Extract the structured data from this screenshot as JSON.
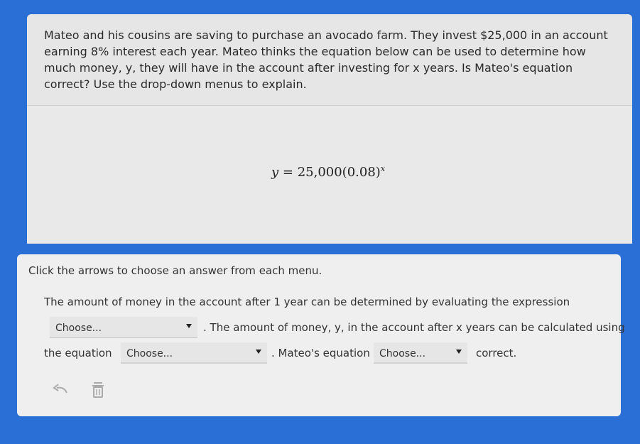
{
  "question": {
    "text": "Mateo and his cousins are saving to purchase an avocado farm. They invest $25,000 in an account earning 8% interest each year. Mateo thinks the equation below can be used to determine how much money, y, they will have in the account after investing for x years. Is Mateo's equation correct? Use the drop-down menus to explain."
  },
  "equation": {
    "lhs": "y",
    "eq": " = ",
    "rhs": "25,000(0.08)",
    "exp": "x"
  },
  "answer": {
    "instruction": "Click the arrows to choose an answer from each menu.",
    "line1": "The amount of money in the account after 1 year can be determined by evaluating the expression",
    "select1": "Choose...",
    "line2_after": ". The amount of money, y, in the account after x years can be calculated using",
    "line3_before": "the equation",
    "select2": "Choose...",
    "line3_mid": ". Mateo's equation",
    "select3": "Choose...",
    "line3_end": "correct."
  },
  "icons": {
    "back": "undo-arrow-icon",
    "delete": "trash-icon"
  },
  "colors": {
    "background": "#2a6fd6",
    "panel_top": "#e6e6e6",
    "panel_bottom": "#efefef"
  }
}
